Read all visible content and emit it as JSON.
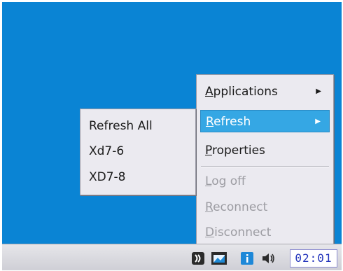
{
  "main_menu": {
    "items": [
      {
        "label": "Applications",
        "accel": "A",
        "rest": "pplications",
        "submenu": true,
        "state": "normal"
      },
      {
        "label": "Refresh",
        "accel": "R",
        "rest": "efresh",
        "submenu": true,
        "state": "selected"
      },
      {
        "label": "Properties",
        "accel": "P",
        "rest": "roperties",
        "submenu": false,
        "state": "normal"
      },
      {
        "label": "Log off",
        "accel": "L",
        "rest": "og off",
        "submenu": false,
        "state": "disabled"
      },
      {
        "label": "Reconnect",
        "accel": "R",
        "rest": "econnect",
        "submenu": false,
        "state": "disabled"
      },
      {
        "label": "Disconnect",
        "accel": "D",
        "rest": "isconnect",
        "submenu": false,
        "state": "disabled"
      }
    ]
  },
  "refresh_submenu": {
    "items": [
      "Refresh All",
      "Xd7-6",
      "XD7-8"
    ]
  },
  "taskbar": {
    "clock": "02:01",
    "tray_icons": [
      "citrix-receiver-icon",
      "desktop-viewer-icon",
      "info-icon",
      "volume-icon"
    ]
  },
  "colors": {
    "desktop": "#0a84d4",
    "menu_bg": "#ebeaf0",
    "selected_bg": "#35a7e4",
    "disabled_text": "#9c9ca2",
    "clock_text": "#2233bb"
  }
}
